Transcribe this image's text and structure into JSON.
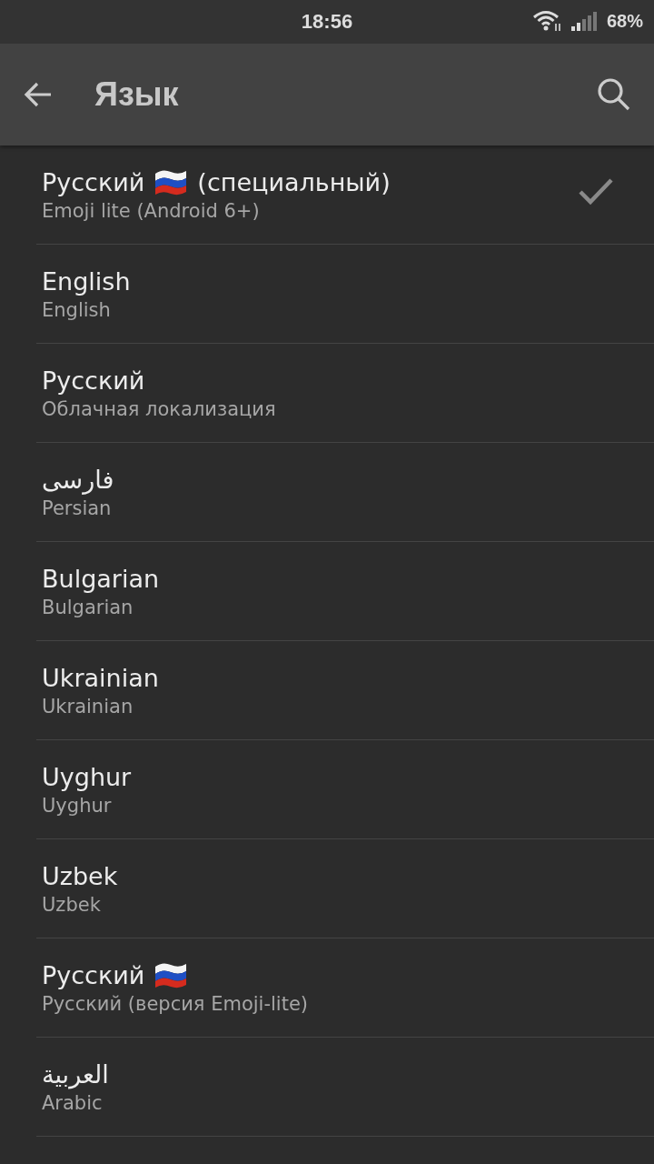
{
  "status_bar": {
    "time": "18:56",
    "battery": "68%"
  },
  "app_bar": {
    "title": "Язык"
  },
  "languages": [
    {
      "title": "Русский",
      "flag": true,
      "title_suffix": "(специальный)",
      "subtitle": "Emoji lite (Android 6+)",
      "selected": true
    },
    {
      "title": "English",
      "flag": false,
      "subtitle": "English",
      "selected": false
    },
    {
      "title": "Русский",
      "flag": false,
      "subtitle": "Облачная локализация",
      "selected": false
    },
    {
      "title": "فارسی",
      "flag": false,
      "subtitle": "Persian",
      "selected": false
    },
    {
      "title": "Bulgarian",
      "flag": false,
      "subtitle": "Bulgarian",
      "selected": false
    },
    {
      "title": "Ukrainian",
      "flag": false,
      "subtitle": "Ukrainian",
      "selected": false
    },
    {
      "title": "Uyghur",
      "flag": false,
      "subtitle": "Uyghur",
      "selected": false
    },
    {
      "title": "Uzbek",
      "flag": false,
      "subtitle": "Uzbek",
      "selected": false
    },
    {
      "title": "Русский",
      "flag": true,
      "subtitle": "Русский (версия Emoji-lite)",
      "selected": false
    },
    {
      "title": "العربية",
      "flag": false,
      "subtitle": "Arabic",
      "selected": false
    }
  ]
}
